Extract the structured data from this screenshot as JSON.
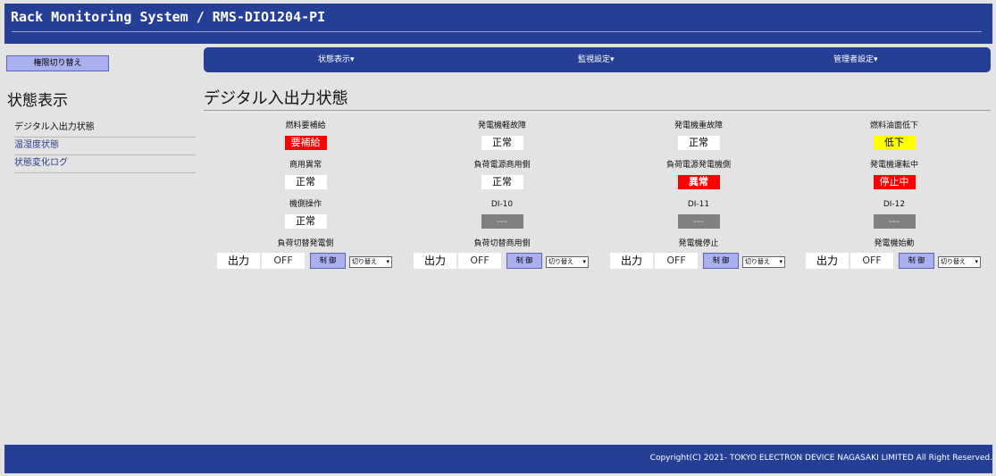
{
  "header": {
    "title": "Rack Monitoring System / RMS-DIO1204-PI"
  },
  "role_button": "権限切り替え",
  "nav": [
    {
      "label": "状態表示▾"
    },
    {
      "label": "監視設定▾"
    },
    {
      "label": "管理者設定▾"
    }
  ],
  "sidebar": {
    "title": "状態表示",
    "items": [
      {
        "label": "デジタル入出力状態"
      },
      {
        "label": "温湿度状態"
      },
      {
        "label": "状態変化ログ"
      }
    ]
  },
  "main": {
    "title": "デジタル入出力状態"
  },
  "inputs": [
    {
      "label": "燃料要補給",
      "status": "要補給",
      "color": "#ff0000"
    },
    {
      "label": "発電機軽故障",
      "status": "正常",
      "color": "#ffffff"
    },
    {
      "label": "発電機重故障",
      "status": "正常",
      "color": "#ffffff"
    },
    {
      "label": "燃料油面低下",
      "status": "低下",
      "color": "#ffff00"
    },
    {
      "label": "商用異常",
      "status": "正常",
      "color": "#ffffff"
    },
    {
      "label": "負荷電源商用側",
      "status": "正常",
      "color": "#ffffff"
    },
    {
      "label": "負荷電源発電機側",
      "status": "異常",
      "color": "#ff0000"
    },
    {
      "label": "発電機運転中",
      "status": "停止中",
      "color": "#ff0000"
    },
    {
      "label": "機側操作",
      "status": "正常",
      "color": "#ffffff"
    },
    {
      "label": "DI-10",
      "status": "---",
      "color": "#808080"
    },
    {
      "label": "DI-11",
      "status": "---",
      "color": "#808080"
    },
    {
      "label": "DI-12",
      "status": "---",
      "color": "#808080"
    }
  ],
  "outputs": [
    {
      "label": "負荷切替発電側",
      "out_label": "出力",
      "value": "OFF",
      "button": "制 御",
      "select": "切り替え"
    },
    {
      "label": "負荷切替商用側",
      "out_label": "出力",
      "value": "OFF",
      "button": "制 御",
      "select": "切り替え"
    },
    {
      "label": "発電機停止",
      "out_label": "出力",
      "value": "OFF",
      "button": "制 御",
      "select": "切り替え"
    },
    {
      "label": "発電機始動",
      "out_label": "出力",
      "value": "OFF",
      "button": "制 御",
      "select": "切り替え"
    }
  ],
  "footer": {
    "copyright": "Copyright(C) 2021- TOKYO ELECTRON DEVICE NAGASAKI LIMITED All Right Reserved."
  }
}
